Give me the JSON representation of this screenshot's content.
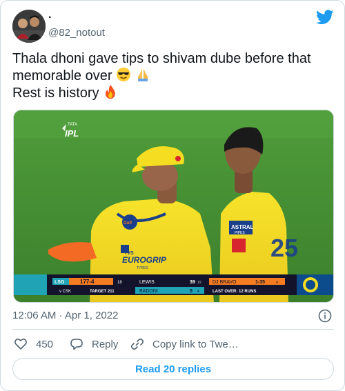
{
  "author": {
    "name": ".",
    "handle": "@82_notout"
  },
  "tweet": {
    "line1": "Thala dhoni gave tips to shivam dube before that",
    "line2": "memorable over",
    "line3": "Rest is history"
  },
  "scoreboard": {
    "team1": "LSG",
    "score": "177-4",
    "overs": "18",
    "vs": "v CSK",
    "target": "TARGET 211",
    "batter1": "LEWIS",
    "batter1_runs": "39",
    "batter1_balls": "19",
    "batter2": "BADONI",
    "batter2_runs": "5",
    "batter2_balls": "4",
    "bowler": "DJ BRAVO",
    "bowler_figures": "1-35",
    "bowler_overs": "4",
    "last_over": "LAST OVER: 12 RUNS"
  },
  "media_text": {
    "ipl": "IPL",
    "tata": "TATA",
    "sponsor": "EUROGRIP",
    "sponsor_sub": "TYRES",
    "tvs": "TVS",
    "astral": "ASTRAL",
    "astral_sub": "PIPES",
    "gulf": "Gulf",
    "jersey_number": "25"
  },
  "timestamp": "12:06 AM · Apr 1, 2022",
  "actions": {
    "likes": "450",
    "reply": "Reply",
    "copy": "Copy link to Twe…"
  },
  "read_replies": "Read 20 replies",
  "colors": {
    "accent": "#1d9bf0",
    "text_secondary": "#536471"
  },
  "icons": [
    "twitter-bird-icon",
    "sunglasses-emoji-icon",
    "folded-hands-emoji-icon",
    "fire-emoji-icon",
    "info-icon",
    "heart-icon",
    "reply-icon",
    "link-icon"
  ]
}
